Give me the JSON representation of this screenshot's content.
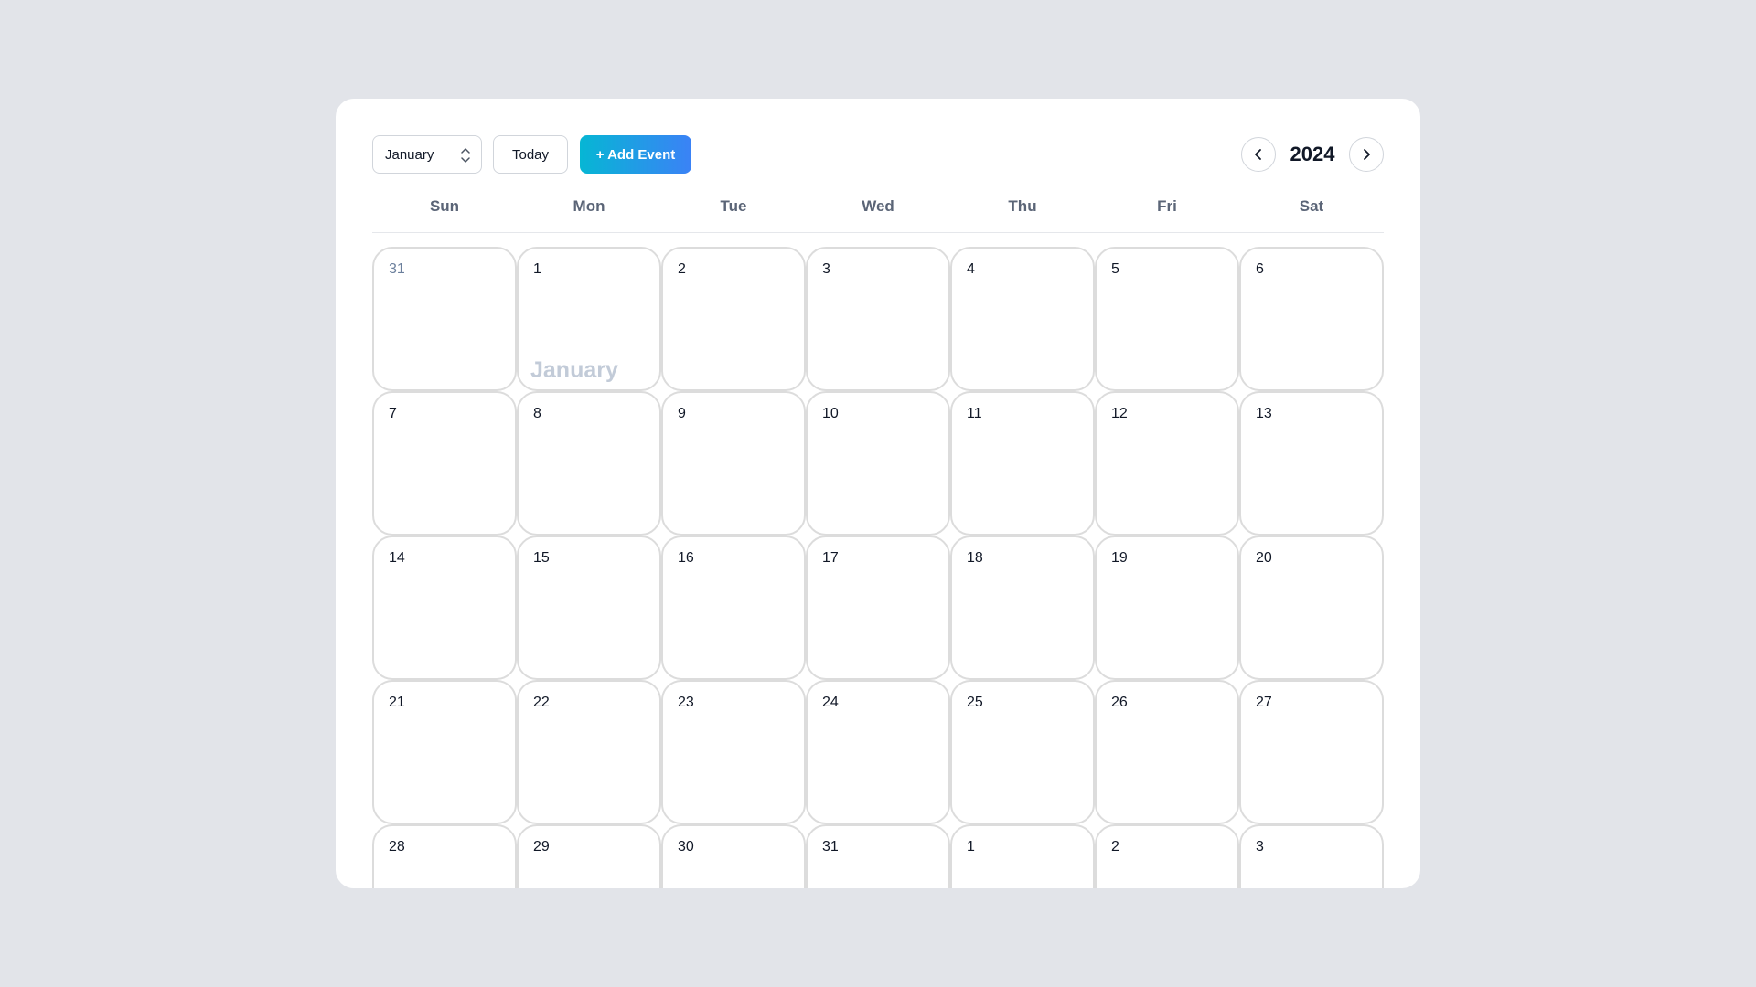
{
  "toolbar": {
    "month_select_value": "January",
    "today_label": "Today",
    "add_event_label": "+ Add Event",
    "year": "2024"
  },
  "weekdays": [
    "Sun",
    "Mon",
    "Tue",
    "Wed",
    "Thu",
    "Fri",
    "Sat"
  ],
  "month_watermark": "January",
  "days": [
    {
      "num": "31",
      "outside": true
    },
    {
      "num": "1",
      "outside": false,
      "watermark": true
    },
    {
      "num": "2",
      "outside": false
    },
    {
      "num": "3",
      "outside": false
    },
    {
      "num": "4",
      "outside": false
    },
    {
      "num": "5",
      "outside": false
    },
    {
      "num": "6",
      "outside": false
    },
    {
      "num": "7",
      "outside": false
    },
    {
      "num": "8",
      "outside": false
    },
    {
      "num": "9",
      "outside": false
    },
    {
      "num": "10",
      "outside": false
    },
    {
      "num": "11",
      "outside": false
    },
    {
      "num": "12",
      "outside": false
    },
    {
      "num": "13",
      "outside": false
    },
    {
      "num": "14",
      "outside": false
    },
    {
      "num": "15",
      "outside": false
    },
    {
      "num": "16",
      "outside": false
    },
    {
      "num": "17",
      "outside": false
    },
    {
      "num": "18",
      "outside": false
    },
    {
      "num": "19",
      "outside": false
    },
    {
      "num": "20",
      "outside": false
    },
    {
      "num": "21",
      "outside": false
    },
    {
      "num": "22",
      "outside": false
    },
    {
      "num": "23",
      "outside": false
    },
    {
      "num": "24",
      "outside": false
    },
    {
      "num": "25",
      "outside": false
    },
    {
      "num": "26",
      "outside": false
    },
    {
      "num": "27",
      "outside": false
    },
    {
      "num": "28",
      "outside": false
    },
    {
      "num": "29",
      "outside": false
    },
    {
      "num": "30",
      "outside": false
    },
    {
      "num": "31",
      "outside": false
    },
    {
      "num": "1",
      "outside": true,
      "next": true
    },
    {
      "num": "2",
      "outside": true,
      "next": true
    },
    {
      "num": "3",
      "outside": true,
      "next": true
    }
  ],
  "colors": {
    "page_background": "#e2e4e9",
    "card_background": "#ffffff",
    "add_button_gradient_start": "#06b6d4",
    "add_button_gradient_end": "#3b82f6",
    "previous_month_day": "#6b7f9c",
    "watermark": "#c2cbd8"
  }
}
